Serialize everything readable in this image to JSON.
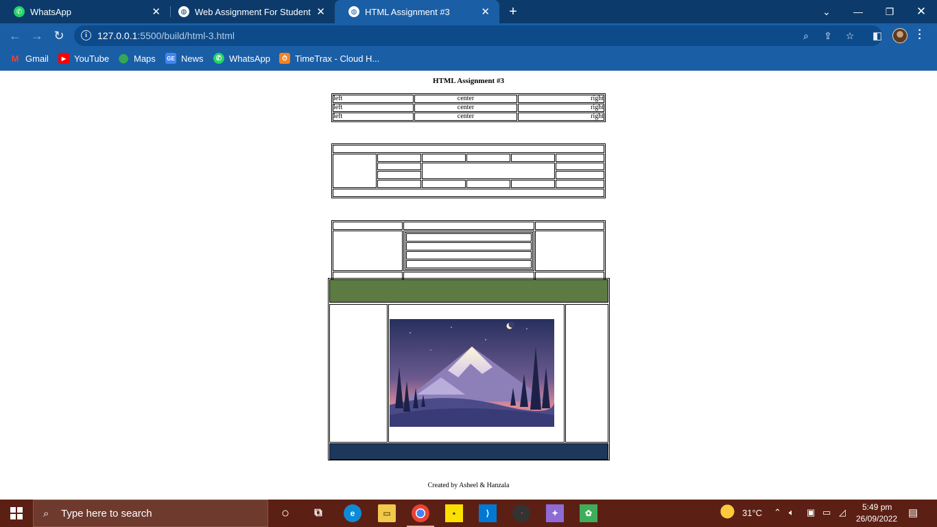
{
  "browser": {
    "tabs": [
      {
        "title": "WhatsApp",
        "icon": "whatsapp-icon",
        "active": false
      },
      {
        "title": "Web Assignment For Student",
        "icon": "globe-icon",
        "active": false
      },
      {
        "title": "HTML Assignment #3",
        "icon": "globe-icon",
        "active": true
      }
    ],
    "url_host": "127.0.0.1",
    "url_path": ":5500/build/html-3.html",
    "bookmarks": [
      {
        "label": "Gmail",
        "icon": "gmail-icon"
      },
      {
        "label": "YouTube",
        "icon": "youtube-icon"
      },
      {
        "label": "Maps",
        "icon": "maps-icon"
      },
      {
        "label": "News",
        "icon": "news-icon"
      },
      {
        "label": "WhatsApp",
        "icon": "whatsapp-icon"
      },
      {
        "label": "TimeTrax - Cloud H...",
        "icon": "timetrax-icon"
      }
    ]
  },
  "page": {
    "title": "HTML Assignment #3",
    "alignment_table": {
      "rows": [
        [
          "left",
          "center",
          "right"
        ],
        [
          "left",
          "center",
          "right"
        ],
        [
          "left",
          "center",
          "right"
        ]
      ]
    },
    "image_alt": "mountain night landscape",
    "colors": {
      "header_band": "#5e7a43",
      "footer_band": "#1e385c"
    },
    "credit": "Created by Asheel & Hanzala"
  },
  "taskbar": {
    "search_placeholder": "Type here to search",
    "weather": "31°C",
    "time": "5:49 pm",
    "date": "26/09/2022"
  }
}
